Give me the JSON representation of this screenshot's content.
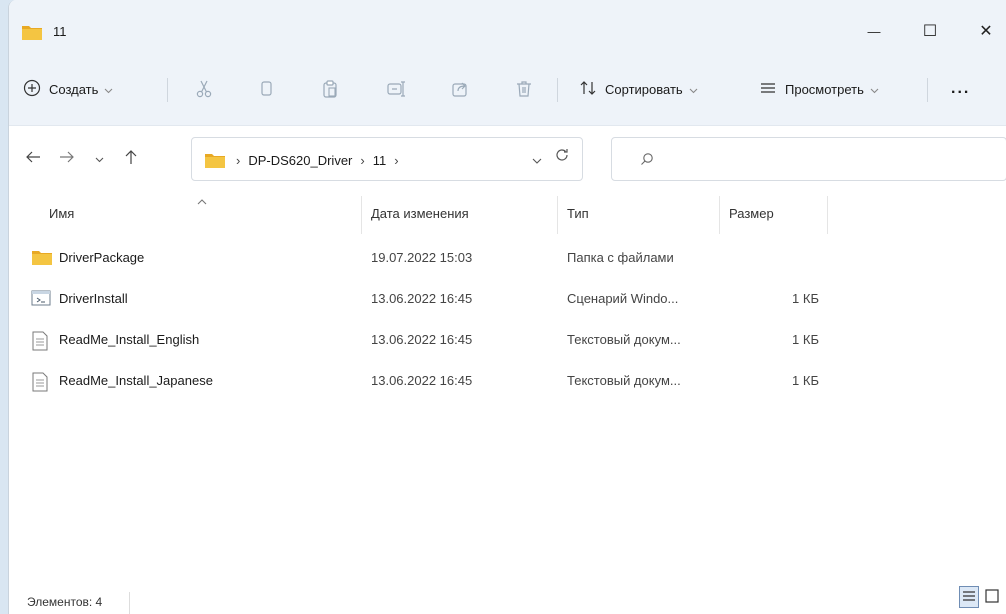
{
  "window": {
    "title": "11",
    "controls": {
      "minimize": "—",
      "maximize": "☐",
      "close": "✕"
    }
  },
  "commandbar": {
    "new_label": "Создать",
    "sort_label": "Сортировать",
    "view_label": "Просмотреть",
    "more_label": "...",
    "tools": [
      "cut-icon",
      "copy-icon",
      "paste-icon",
      "rename-icon",
      "share-icon",
      "delete-icon"
    ]
  },
  "address": {
    "crumbs": [
      "DP-DS620_Driver",
      "11"
    ],
    "separator": "›"
  },
  "search": {
    "placeholder": ""
  },
  "columns": {
    "name": "Имя",
    "date": "Дата изменения",
    "type": "Тип",
    "size": "Размер"
  },
  "files": [
    {
      "name": "DriverPackage",
      "date": "19.07.2022 15:03",
      "type": "Папка с файлами",
      "size": "",
      "icon": "folder-icon"
    },
    {
      "name": "DriverInstall",
      "date": "13.06.2022 16:45",
      "type": "Сценарий Windo...",
      "size": "1 КБ",
      "icon": "script-icon"
    },
    {
      "name": "ReadMe_Install_English",
      "date": "13.06.2022 16:45",
      "type": "Текстовый докум...",
      "size": "1 КБ",
      "icon": "text-file-icon"
    },
    {
      "name": "ReadMe_Install_Japanese",
      "date": "13.06.2022 16:45",
      "type": "Текстовый докум...",
      "size": "1 КБ",
      "icon": "text-file-icon"
    }
  ],
  "status": {
    "items_label": "Элементов: 4"
  },
  "colors": {
    "folder": "#f4c542",
    "accent": "#0067c0",
    "chrome": "#eef3f9"
  }
}
